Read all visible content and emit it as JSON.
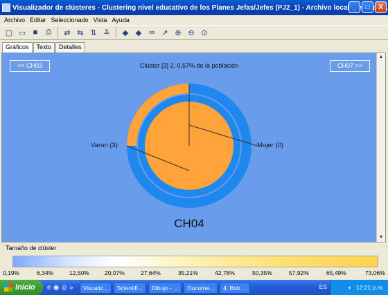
{
  "window": {
    "title": "Visualizador de clústeres - Clustering nivel educativo de los Planes Jefas/Jefes (PJ2_1) - Archivo local: general I...",
    "buttons": [
      "_",
      "□",
      "X"
    ]
  },
  "menu": [
    "Archivo",
    "Editar",
    "Seleccionado",
    "Vista",
    "Ayuda"
  ],
  "toolbar_icons": [
    "new-icon",
    "open-icon",
    "save-icon",
    "print-icon",
    "swap-icon",
    "refresh-icon",
    "sort-icon",
    "filter-icon",
    "arrow-left-icon",
    "arrow-right-icon",
    "binoculars-icon",
    "pointer-icon",
    "zoom-in-icon",
    "zoom-out-icon",
    "zoom-reset-icon"
  ],
  "tabs": [
    "Gráficos",
    "Texto",
    "Detalles"
  ],
  "chart": {
    "prev_label": "<< CH03",
    "next_label": "CH07 >>",
    "cluster_label": "Clúster [3] 2, 0,57% de la población",
    "center_label": "CH04",
    "left_label": "Varon (3)",
    "right_label": "Mujer (0)",
    "colors": {
      "orange": "#ffa33a",
      "blue": "#1e88ee",
      "panel": "#6a9cec"
    }
  },
  "chart_data": {
    "type": "pie",
    "title": "Clúster [3] 2, 0,57% de la población",
    "categories": [
      "Varon",
      "Mujer"
    ],
    "values": [
      3,
      0
    ],
    "outer_ring_fill_fraction": 0.25,
    "center_label": "CH04"
  },
  "legend": {
    "title": "Tamaño de clúster",
    "ticks": [
      "0,19%",
      "6,34%",
      "12,50%",
      "20,07%",
      "27,64%",
      "35,21%",
      "42,78%",
      "50,35%",
      "57,92%",
      "65,49%",
      "73,06%"
    ]
  },
  "taskbar": {
    "start": "Inicio",
    "items": [
      "Visualiz...",
      "Scientifi...",
      "Dibujo - ...",
      "Docume...",
      "4. Bob ..."
    ],
    "lang": "ES",
    "clock": "12:21 p.m."
  }
}
